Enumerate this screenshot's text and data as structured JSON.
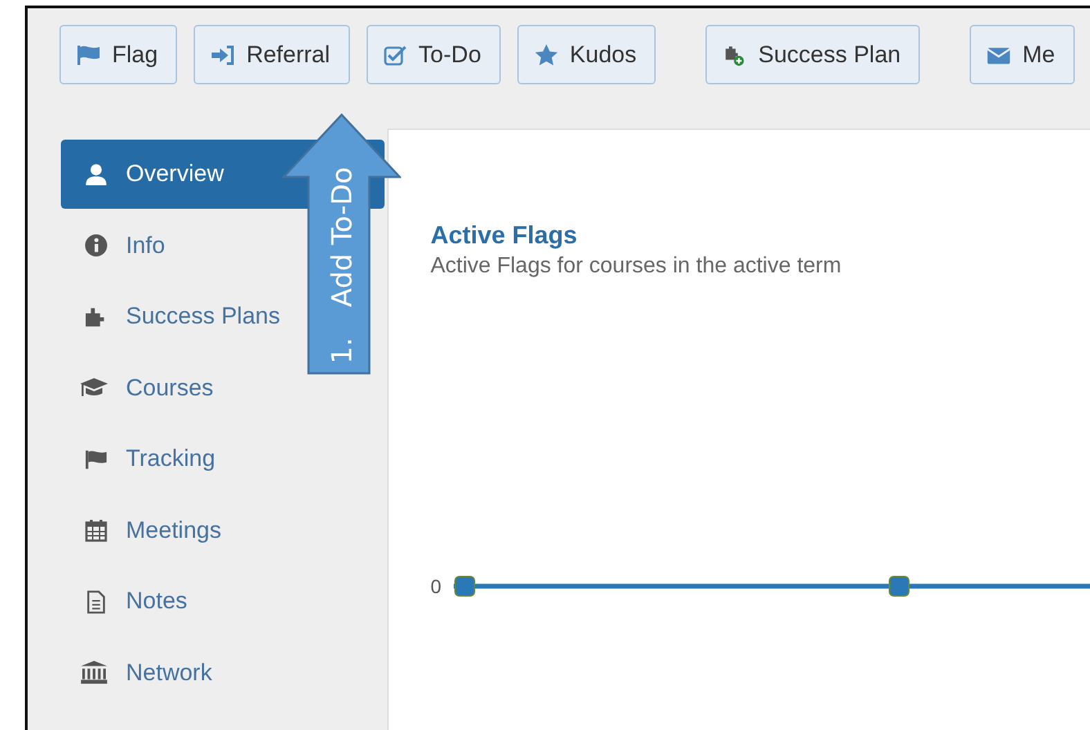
{
  "toolbar": {
    "groups": [
      {
        "buttons": [
          {
            "label": "Flag"
          },
          {
            "label": "Referral"
          },
          {
            "label": "To-Do"
          },
          {
            "label": "Kudos"
          }
        ]
      },
      {
        "buttons": [
          {
            "label": "Success Plan"
          }
        ]
      },
      {
        "buttons": [
          {
            "label": "Me"
          }
        ]
      }
    ]
  },
  "sidebar": {
    "items": [
      {
        "label": "Overview",
        "selected": true
      },
      {
        "label": "Info",
        "selected": false
      },
      {
        "label": "Success Plans",
        "selected": false
      },
      {
        "label": "Courses",
        "selected": false
      },
      {
        "label": "Tracking",
        "selected": false
      },
      {
        "label": "Meetings",
        "selected": false
      },
      {
        "label": "Notes",
        "selected": false
      },
      {
        "label": "Network",
        "selected": false
      }
    ]
  },
  "panel": {
    "title": "Active Flags",
    "subtitle": "Active Flags for courses in the active term",
    "y_tick_label": "0"
  },
  "callout": {
    "number": "1.",
    "text": "Add To-Do"
  }
}
